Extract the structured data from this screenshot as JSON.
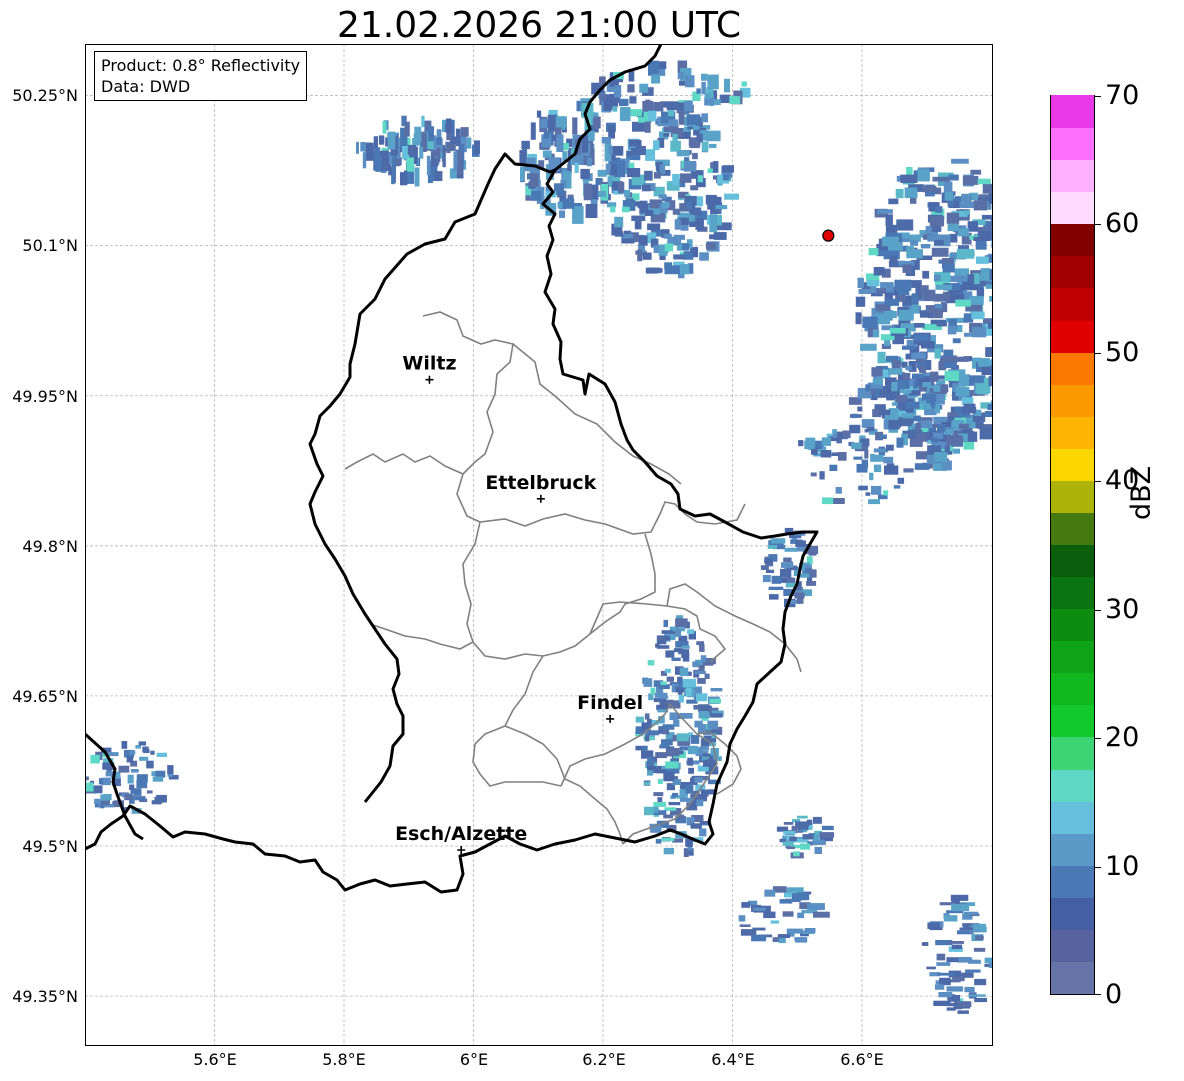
{
  "title": "21.02.2026 21:00 UTC",
  "info": {
    "product": "Product: 0.8° Reflectivity",
    "source": "Data: DWD"
  },
  "axes": {
    "lat_labels": [
      "50.25°N",
      "50.1°N",
      "49.95°N",
      "49.8°N",
      "49.65°N",
      "49.5°N",
      "49.35°N"
    ],
    "lon_labels": [
      "5.6°E",
      "5.8°E",
      "6°E",
      "6.2°E",
      "6.4°E",
      "6.6°E"
    ],
    "grid": true
  },
  "cities": [
    {
      "name": "Wiltz",
      "lat": 49.966,
      "lon": 5.932
    },
    {
      "name": "Ettelbruck",
      "lat": 49.847,
      "lon": 6.104
    },
    {
      "name": "Findel",
      "lat": 49.627,
      "lon": 6.211
    },
    {
      "name": "Esch/Alzette",
      "lat": 49.496,
      "lon": 5.981
    }
  ],
  "radar_site": {
    "lat": 50.11,
    "lon": 6.548,
    "color": "#e00000"
  },
  "colorbar": {
    "label": "dBZ",
    "ticks": [
      "0",
      "10",
      "20",
      "30",
      "40",
      "50",
      "60",
      "70"
    ],
    "colors": [
      "#6674a8",
      "#56639f",
      "#4460a3",
      "#4b79b5",
      "#5b9ac8",
      "#66c0dc",
      "#5fd8c6",
      "#3dd475",
      "#12c82a",
      "#10b81e",
      "#0fa418",
      "#0d8c12",
      "#0a7410",
      "#0a5e0c",
      "#457a10",
      "#adb308",
      "#fcd600",
      "#fcb400",
      "#fc9800",
      "#fc7800",
      "#e00000",
      "#c00000",
      "#a00000",
      "#800000",
      "#ffdcff",
      "#ffb0ff",
      "#ff70ff",
      "#e838e8"
    ]
  }
}
